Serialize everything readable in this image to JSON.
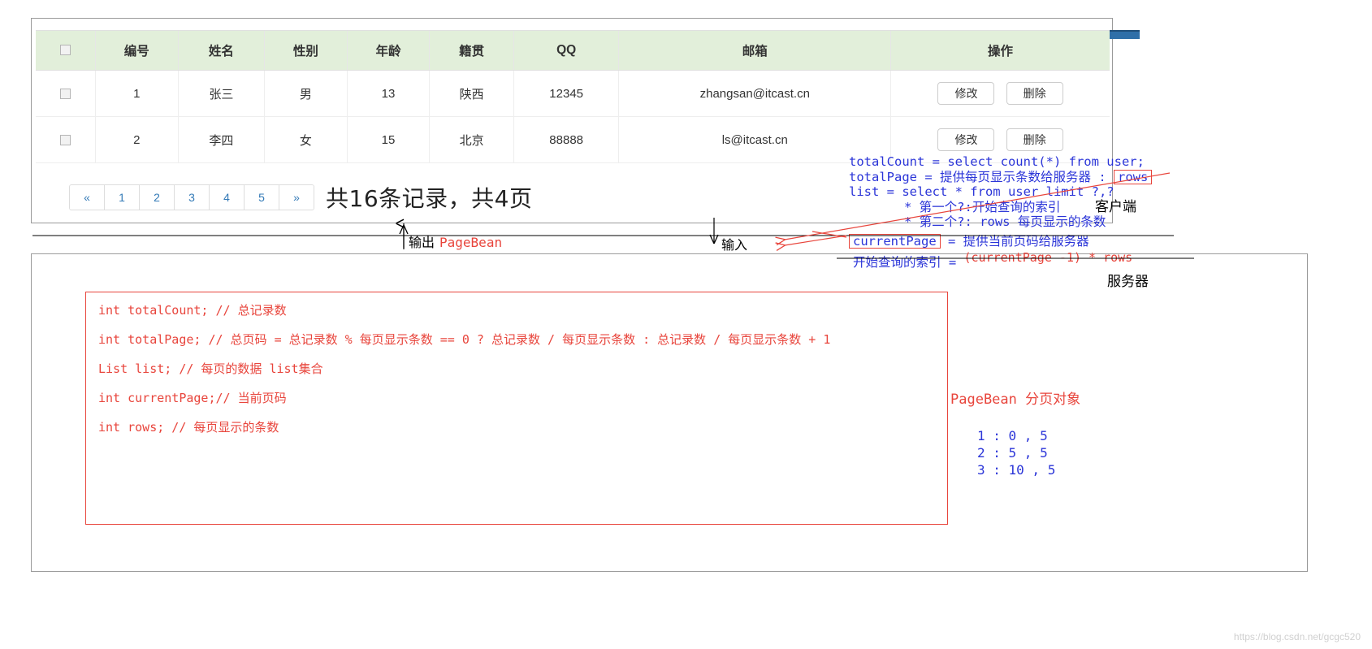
{
  "table": {
    "headers": [
      "",
      "编号",
      "姓名",
      "性别",
      "年龄",
      "籍贯",
      "QQ",
      "邮箱",
      "操作"
    ],
    "rows": [
      {
        "id": "1",
        "name": "张三",
        "gender": "男",
        "age": "13",
        "native": "陕西",
        "qq": "12345",
        "email": "zhangsan@itcast.cn",
        "edit_label": "修改",
        "delete_label": "删除"
      },
      {
        "id": "2",
        "name": "李四",
        "gender": "女",
        "age": "15",
        "native": "北京",
        "qq": "88888",
        "email": "ls@itcast.cn",
        "edit_label": "修改",
        "delete_label": "删除"
      }
    ]
  },
  "pagination": {
    "prev": "«",
    "pages": [
      "1",
      "2",
      "3",
      "4",
      "5"
    ],
    "next": "»",
    "summary": "共16条记录，共4页"
  },
  "io": {
    "output_label": "输出",
    "output_value": "PageBean",
    "input_label": "输入"
  },
  "annotations": {
    "line1": "totalCount = select count(*) from user;",
    "line2_pre": "totalPage = 提供每页显示条数给服务器 : ",
    "line2_boxed": "rows",
    "line3": "list = select * from user limit ?,?",
    "line4": "* 第一个?:开始查询的索引",
    "line5": "* 第二个?: rows 每页显示的条数",
    "currentpage_boxed": "currentPage",
    "currentpage_rest": " = 提供当前页码给服务器",
    "index_label": "开始查询的索引 = ",
    "index_formula": "(currentPage -1) * rows",
    "client_label": "客户端",
    "server_label": "服务器"
  },
  "code": {
    "lines": [
      "int totalCount; // 总记录数",
      "int totalPage; // 总页码 = 总记录数 % 每页显示条数 == 0 ? 总记录数 / 每页显示条数 : 总记录数 / 每页显示条数 + 1",
      "List list;  // 每页的数据 list集合",
      "int currentPage;// 当前页码",
      "int rows; // 每页显示的条数"
    ]
  },
  "pagebean": {
    "title": "PageBean 分页对象",
    "entries": [
      "1 : 0 , 5",
      "2 : 5 , 5",
      "3 : 10 , 5"
    ]
  },
  "watermark": "https://blog.csdn.net/gcgc520",
  "colors": {
    "red": "#e8453c",
    "blue": "#2b35d8",
    "header_green": "#e2efda",
    "link_blue": "#337ab7"
  }
}
